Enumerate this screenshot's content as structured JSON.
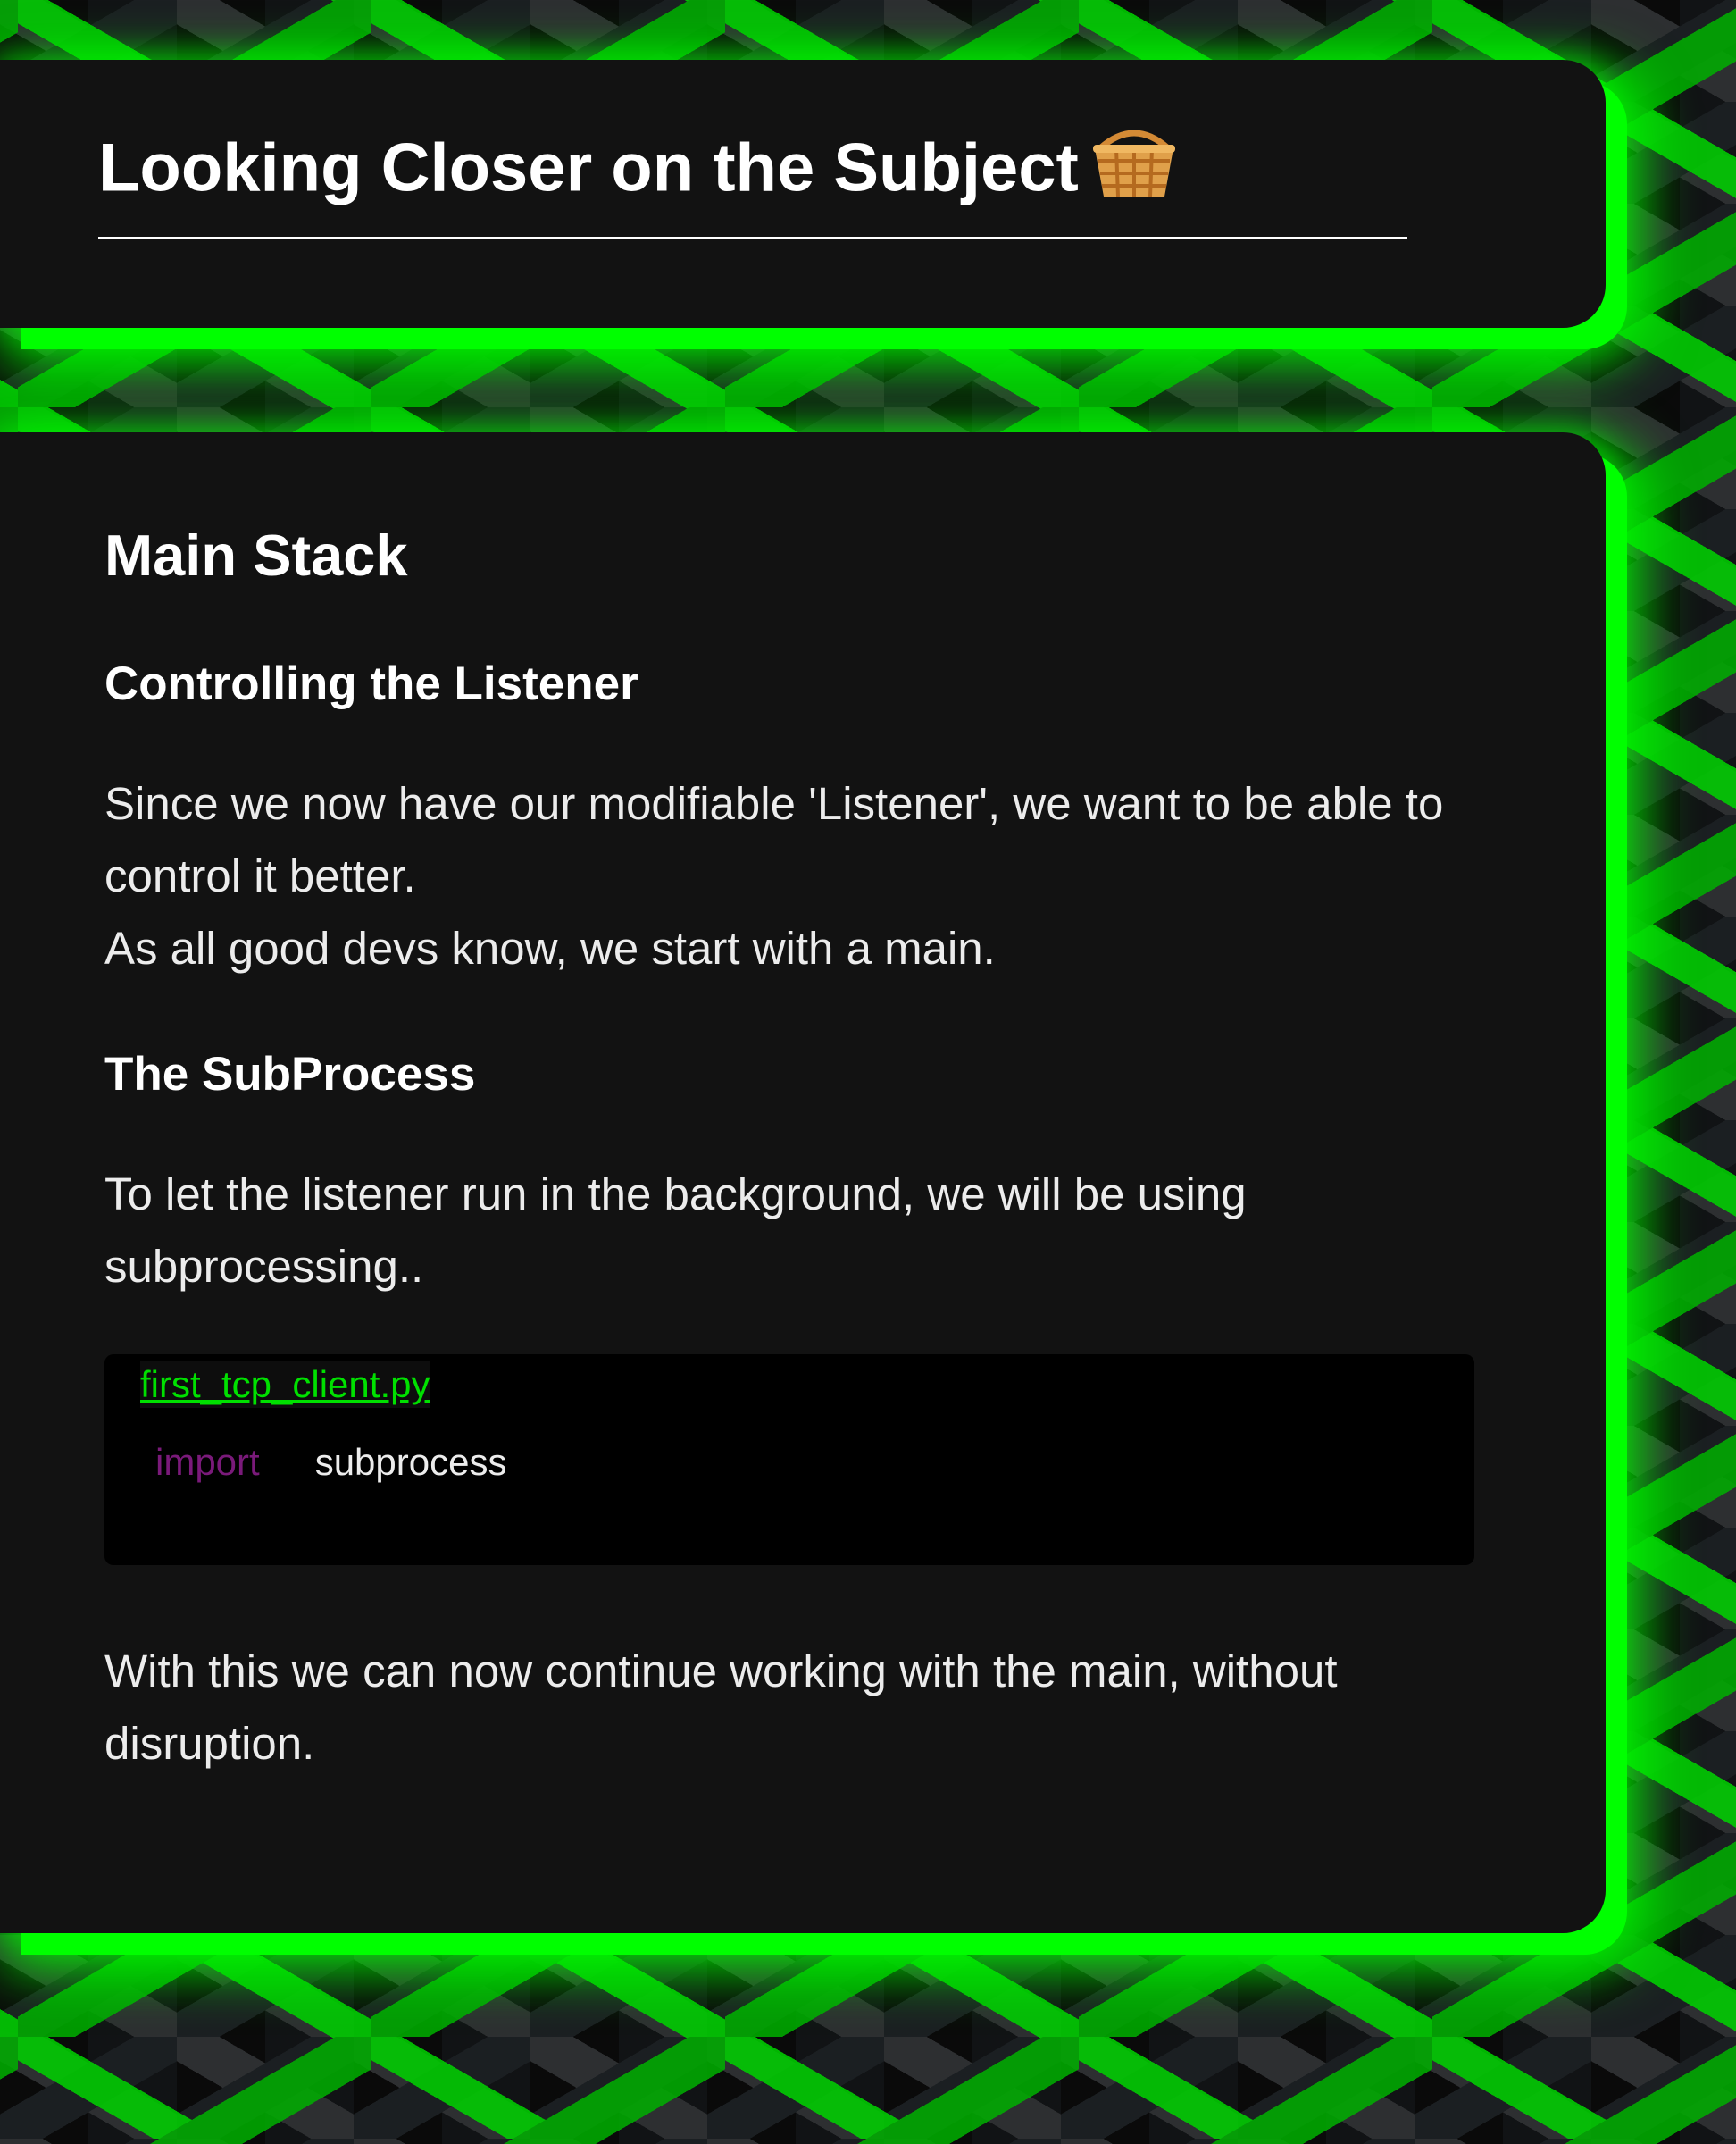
{
  "header": {
    "title": "Looking Closer on the Subject",
    "emoji": "basket-icon"
  },
  "main": {
    "heading": "Main Stack",
    "section1": {
      "heading": "Controlling the Listener",
      "paragraph_line1": "Since we now have our modifiable 'Listener', we want to be able to control it better.",
      "paragraph_line2": "As all good devs know, we start with a main."
    },
    "section2": {
      "heading": "The SubProcess",
      "paragraph": "To let the listener run in the background, we will be using subprocessing.."
    },
    "code": {
      "filename": "first_tcp_client.py",
      "keyword": "import",
      "module": "subprocess",
      "colors": {
        "keyword": "#7a1a7a",
        "filename": "#00e000",
        "background": "#000000"
      }
    },
    "closing_paragraph": "With this we can now continue working with the main, without disruption."
  },
  "theme": {
    "accent": "#00ff00",
    "panel": "#121212",
    "text": "#ececec"
  }
}
